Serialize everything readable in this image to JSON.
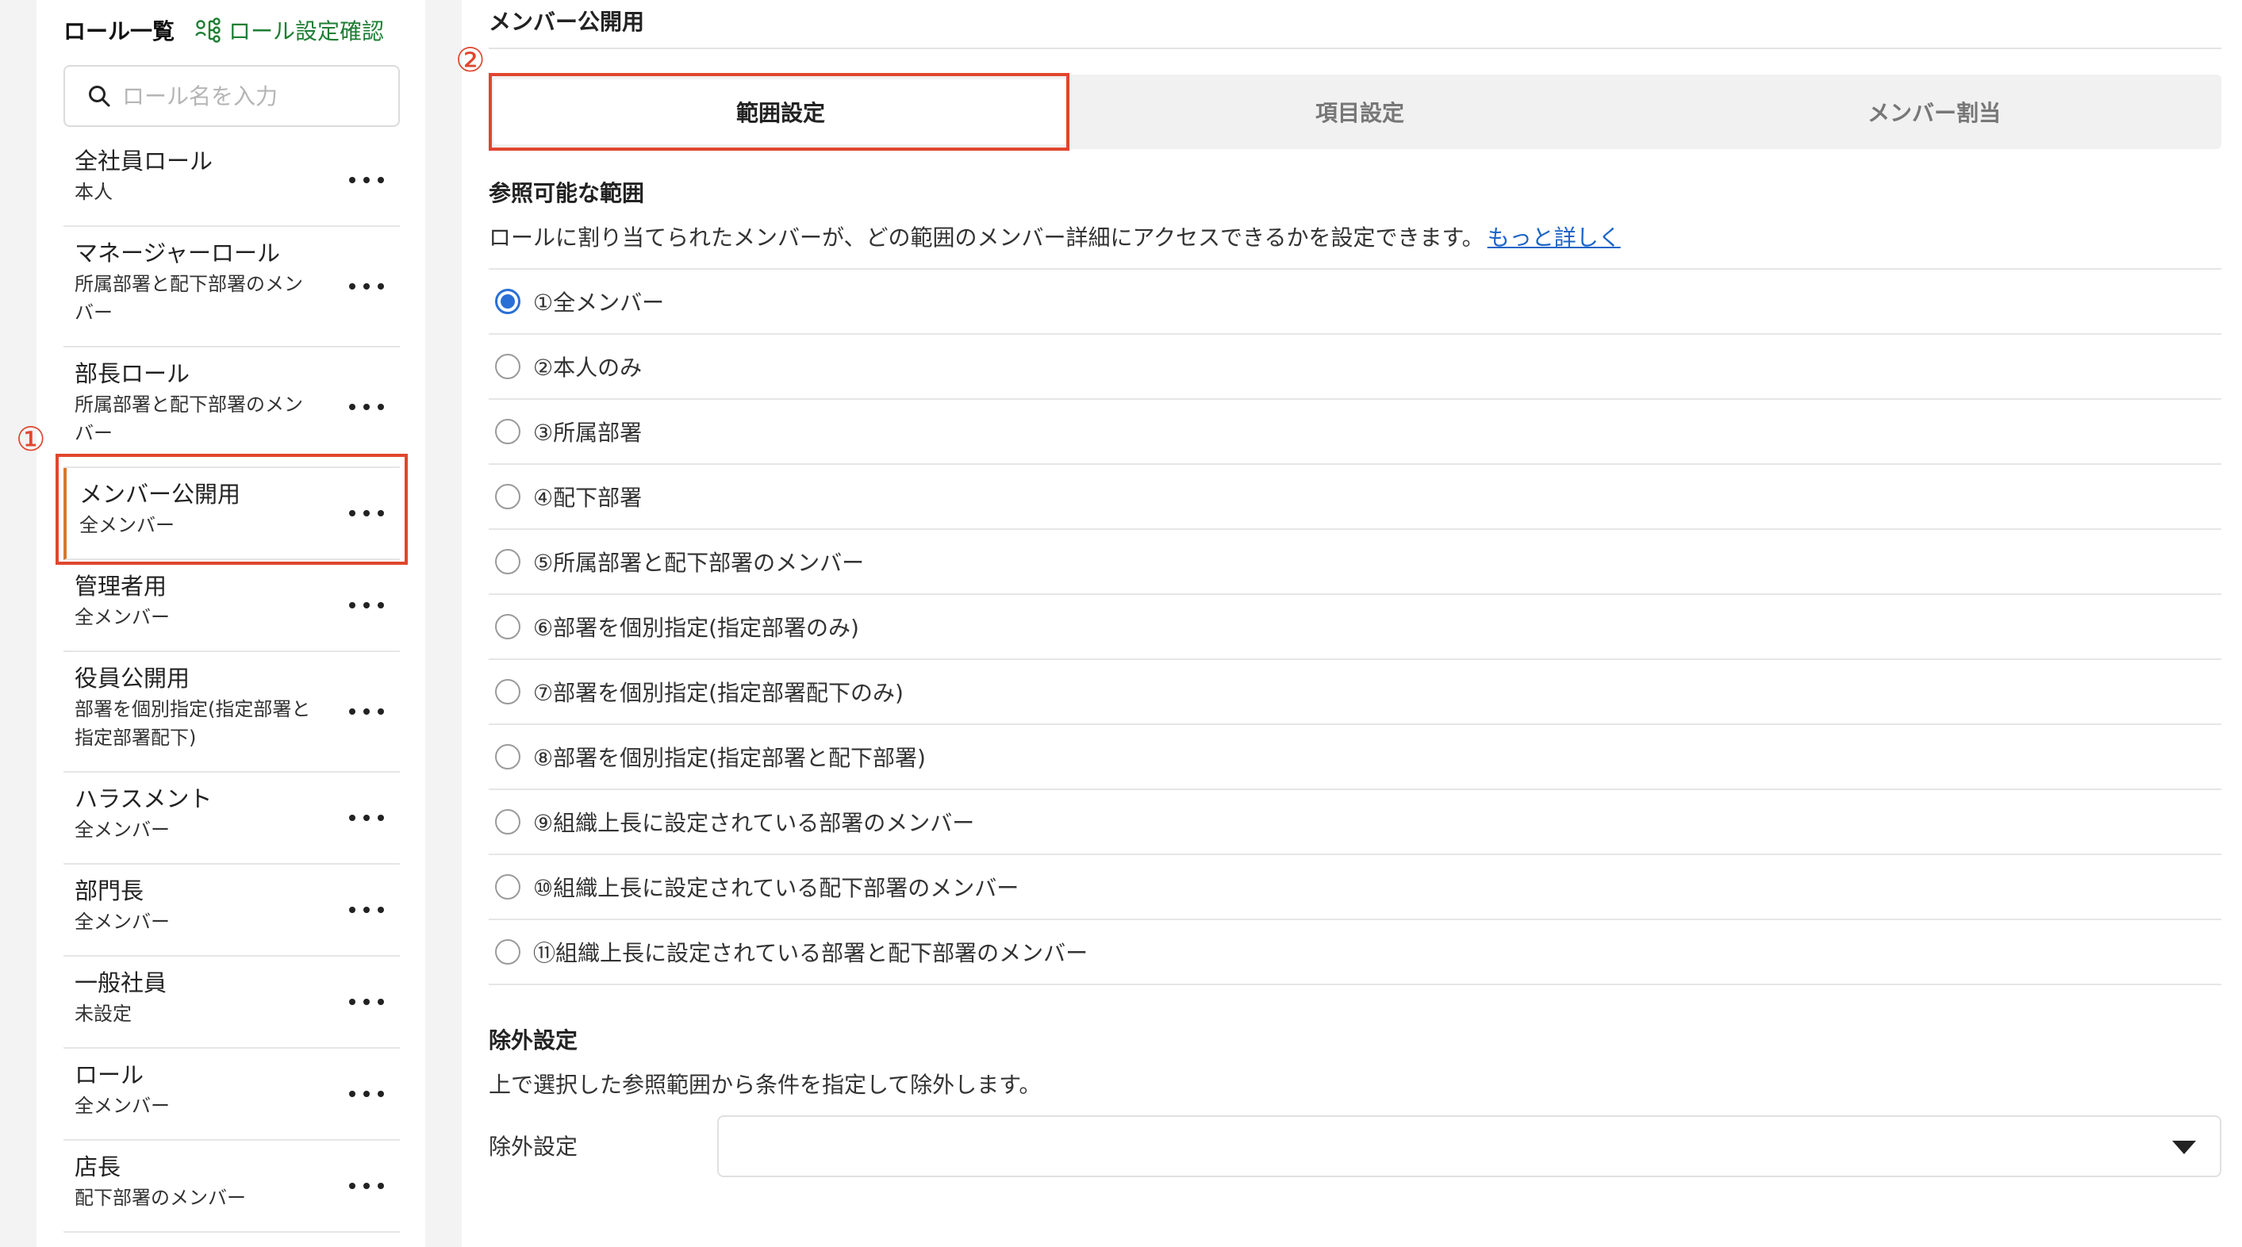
{
  "sidebar": {
    "title": "ロール一覧",
    "settings_link": "ロール設定確認",
    "search_placeholder": "ロール名を入力",
    "roles": [
      {
        "name": "全社員ロール",
        "sub": "本人"
      },
      {
        "name": "マネージャーロール",
        "sub": "所属部署と配下部署のメンバー"
      },
      {
        "name": "部長ロール",
        "sub": "所属部署と配下部署のメンバー"
      },
      {
        "name": "メンバー公開用",
        "sub": "全メンバー",
        "selected": true
      },
      {
        "name": "管理者用",
        "sub": "全メンバー"
      },
      {
        "name": "役員公開用",
        "sub": "部署を個別指定(指定部署と指定部署配下)"
      },
      {
        "name": "ハラスメント",
        "sub": "全メンバー"
      },
      {
        "name": "部門長",
        "sub": "全メンバー"
      },
      {
        "name": "一般社員",
        "sub": "未設定"
      },
      {
        "name": "ロール",
        "sub": "全メンバー"
      },
      {
        "name": "店長",
        "sub": "配下部署のメンバー"
      }
    ]
  },
  "annotations": {
    "one": "①",
    "two": "②"
  },
  "main": {
    "title": "メンバー公開用",
    "tabs": [
      {
        "label": "範囲設定",
        "active": true
      },
      {
        "label": "項目設定"
      },
      {
        "label": "メンバー割当"
      }
    ],
    "scope": {
      "title": "参照可能な範囲",
      "desc": "ロールに割り当てられたメンバーが、どの範囲のメンバー詳細にアクセスできるかを設定できます。",
      "link": "もっと詳しく",
      "options": [
        "①全メンバー",
        "②本人のみ",
        "③所属部署",
        "④配下部署",
        "⑤所属部署と配下部署のメンバー",
        "⑥部署を個別指定(指定部署のみ)",
        "⑦部署を個別指定(指定部署配下のみ)",
        "⑧部署を個別指定(指定部署と配下部署)",
        "⑨組織上長に設定されている部署のメンバー",
        "⑩組織上長に設定されている配下部署のメンバー",
        "⑪組織上長に設定されている部署と配下部署のメンバー"
      ],
      "selected_index": 0
    },
    "exclusion": {
      "title": "除外設定",
      "desc": "上で選択した参照範囲から条件を指定して除外します。",
      "field_label": "除外設定",
      "value": ""
    }
  },
  "colors": {
    "accent_red": "#e0462d",
    "link_blue": "#1a64c8",
    "brand_green": "#1e7e34",
    "selected_bar": "#d9772b"
  }
}
